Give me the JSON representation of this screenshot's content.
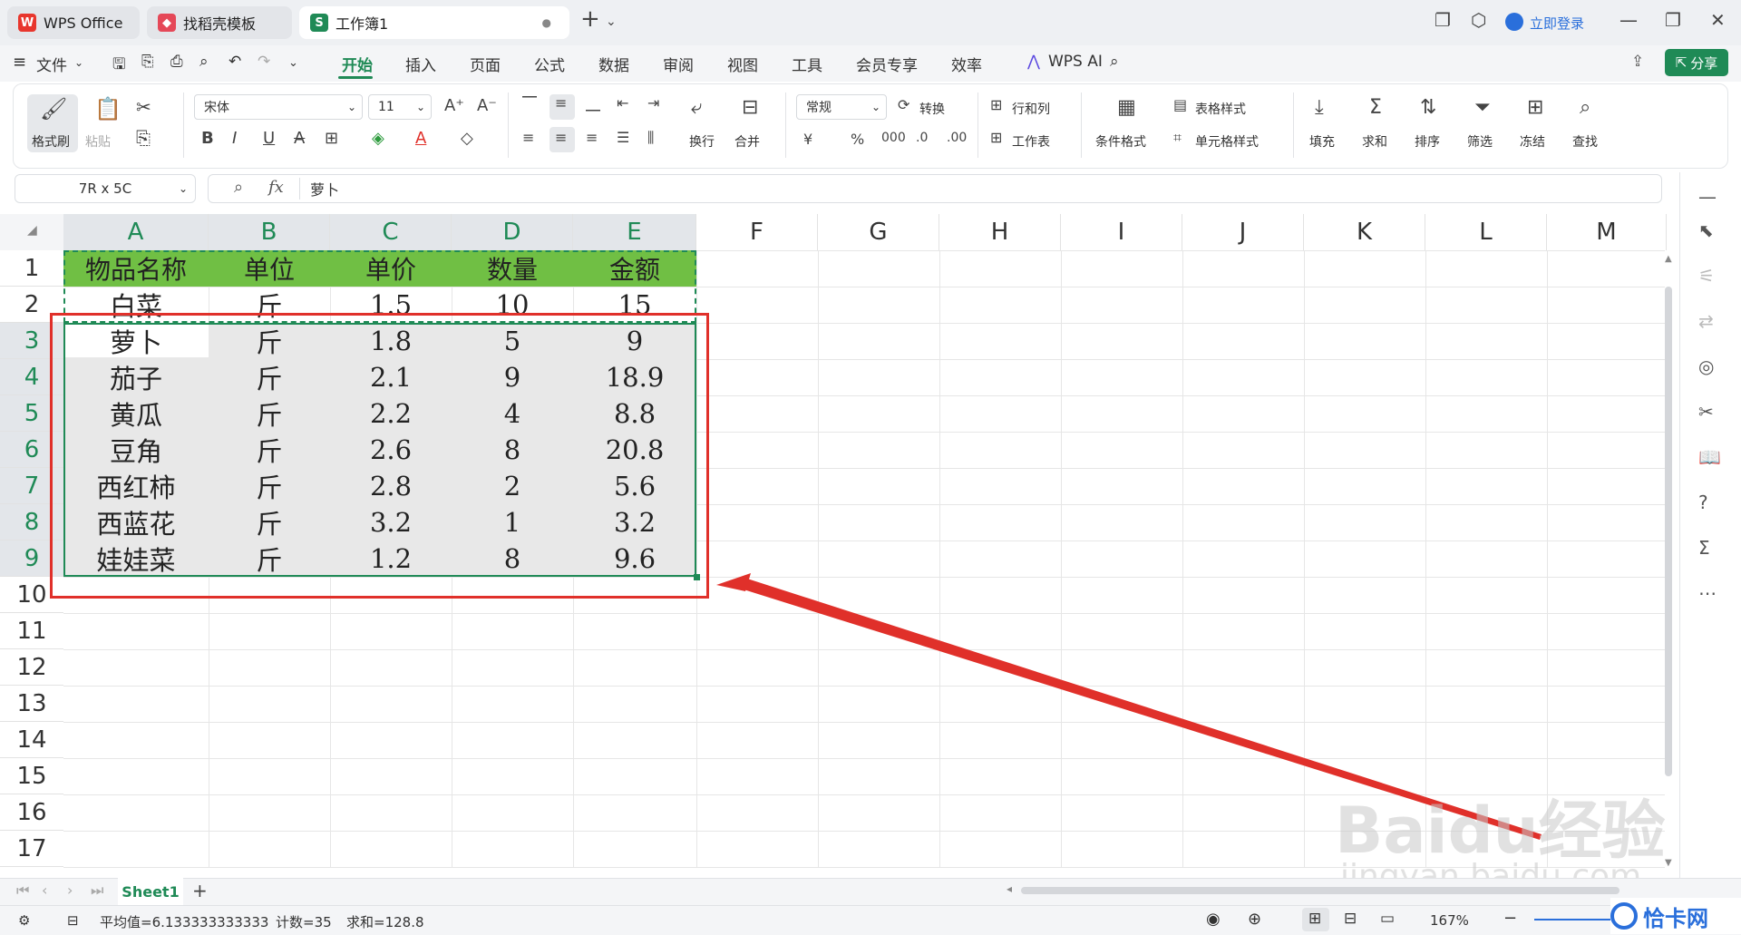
{
  "tabs": [
    {
      "label": "WPS Office",
      "icon": "wps-logo-icon"
    },
    {
      "label": "找稻壳模板",
      "icon": "docer-icon"
    },
    {
      "label": "工作簿1",
      "icon": "sheet-icon"
    }
  ],
  "titlebar": {
    "login_label": "立即登录",
    "new_tab": "+"
  },
  "menu": {
    "file_label": "文件",
    "items": [
      "开始",
      "插入",
      "页面",
      "公式",
      "数据",
      "审阅",
      "视图",
      "工具",
      "会员专享",
      "效率"
    ],
    "wps_ai": "WPS AI",
    "share_label": "分享"
  },
  "ribbon": {
    "format_painter": "格式刷",
    "paste": "粘贴",
    "font_name": "宋体",
    "font_size": "11",
    "wrap": "换行",
    "merge": "合并",
    "number_format": "常规",
    "convert": "转换",
    "row_col": "行和列",
    "sheet": "工作表",
    "cond_format": "条件格式",
    "table_style": "表格样式",
    "cell_style": "单元格样式",
    "fill": "填充",
    "sum": "求和",
    "sort": "排序",
    "filter": "筛选",
    "freeze": "冻结",
    "find": "查找"
  },
  "formula_bar": {
    "name_box": "7R x 5C",
    "fx": "fx",
    "content": "萝卜"
  },
  "columns": [
    "A",
    "B",
    "C",
    "D",
    "E",
    "F",
    "G",
    "H",
    "I",
    "J",
    "K",
    "L",
    "M"
  ],
  "rows": [
    "1",
    "2",
    "3",
    "4",
    "5",
    "6",
    "7",
    "8",
    "9",
    "10",
    "11",
    "12",
    "13",
    "14",
    "15",
    "16",
    "17"
  ],
  "table": {
    "header": [
      "物品名称",
      "单位",
      "单价",
      "数量",
      "金额"
    ],
    "data": [
      [
        "白菜",
        "斤",
        "1.5",
        "10",
        "15"
      ],
      [
        "萝卜",
        "斤",
        "1.8",
        "5",
        "9"
      ],
      [
        "茄子",
        "斤",
        "2.1",
        "9",
        "18.9"
      ],
      [
        "黄瓜",
        "斤",
        "2.2",
        "4",
        "8.8"
      ],
      [
        "豆角",
        "斤",
        "2.6",
        "8",
        "20.8"
      ],
      [
        "西红柿",
        "斤",
        "2.8",
        "2",
        "5.6"
      ],
      [
        "西蓝花",
        "斤",
        "3.2",
        "1",
        "3.2"
      ],
      [
        "娃娃菜",
        "斤",
        "1.2",
        "8",
        "9.6"
      ]
    ]
  },
  "sheet_tab": "Sheet1",
  "status": {
    "average": "平均值=6.133333333333",
    "count": "计数=35",
    "sum": "求和=128.8",
    "zoom": "167%"
  },
  "watermark": {
    "text": "Baidu经验",
    "url": "jingyan.baidu.com",
    "corner_logo": "恰卡网"
  },
  "colors": {
    "accent": "#1f8a56",
    "header_fill": "#70bf44",
    "annotation_red": "#e0302a",
    "selection_green": "#1f8a56"
  }
}
